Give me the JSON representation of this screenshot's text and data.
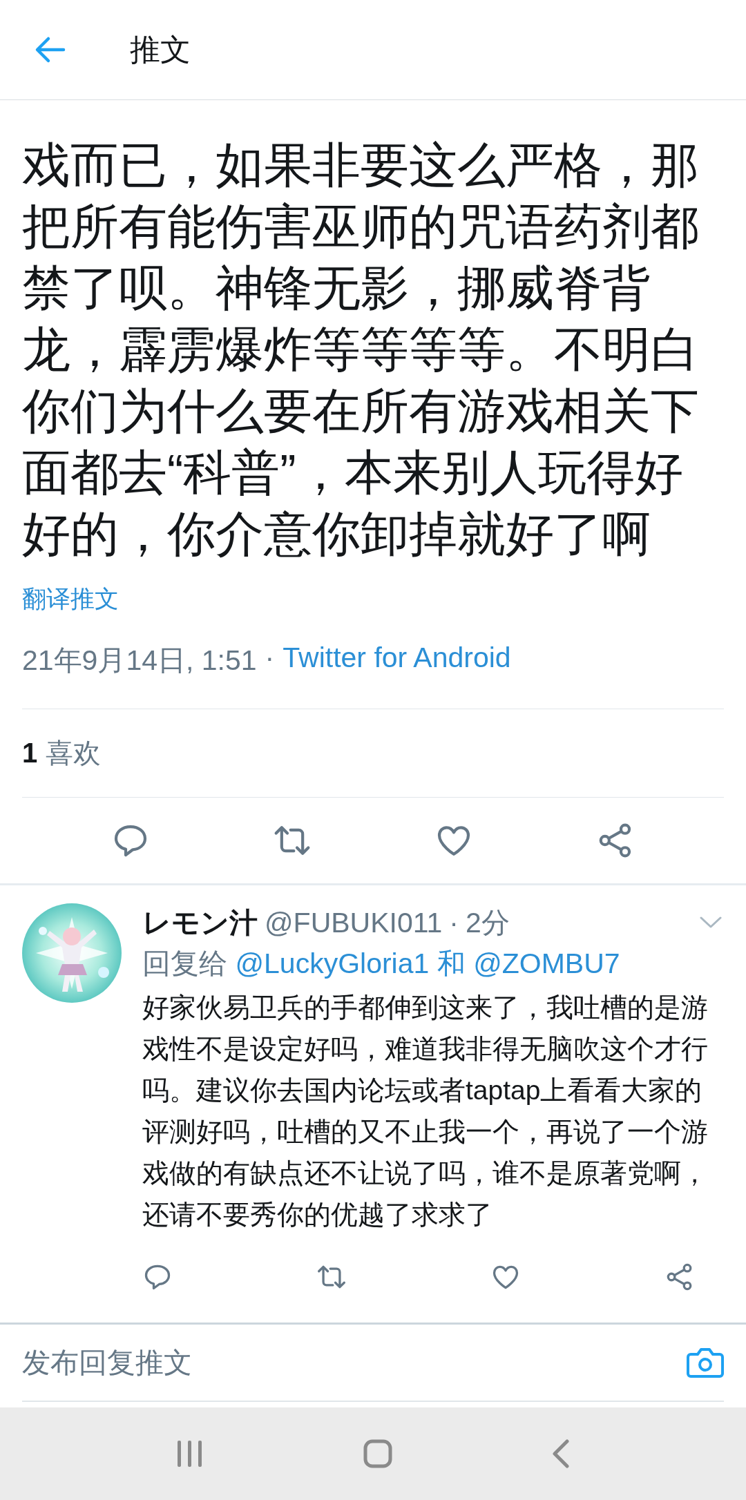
{
  "header": {
    "title": "推文"
  },
  "tweet": {
    "text": "戏而已，如果非要这么严格，那把所有能伤害巫师的咒语药剂都禁了呗。神锋无影，挪威脊背龙，霹雳爆炸等等等等。不明白你们为什么要在所有游戏相关下面都去“科普”，本来别人玩得好好的，你介意你卸掉就好了啊",
    "translate": "翻译推文",
    "timestamp": "21年9月14日, 1:51",
    "separator": "·",
    "source": "Twitter for Android",
    "likes": {
      "count": "1",
      "label": "喜欢"
    }
  },
  "reply": {
    "name": "レモン汁",
    "handle": "@FUBUKI011",
    "separator": "·",
    "time": "2分",
    "reply_to_label": "回复给",
    "mentions": [
      "@LuckyGloria1",
      "@ZOMBU7"
    ],
    "conjunction": "和",
    "text": "好家伙易卫兵的手都伸到这来了，我吐槽的是游戏性不是设定好吗，难道我非得无脑吹这个才行吗。建议你去国内论坛或者taptap上看看大家的评测好吗，吐槽的又不止我一个，再说了一个游戏做的有缺点还不让说了吗，谁不是原著党啊，还请不要秀你的优越了求求了"
  },
  "compose": {
    "placeholder": "发布回复推文"
  }
}
